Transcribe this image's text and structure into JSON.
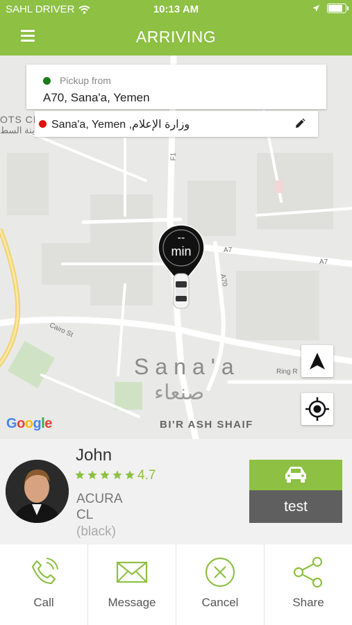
{
  "status_bar": {
    "carrier": "SAHL DRIVER",
    "time": "10:13 AM",
    "battery_level": 0.9
  },
  "header": {
    "title": "ARRIVING",
    "menu_icon": "hamburger-menu-icon"
  },
  "pickup": {
    "label": "Pickup from",
    "address": "A70,  Sana'a,  Yemen",
    "dot_color": "#1a7a1a"
  },
  "dropoff": {
    "address": "Sana'a,  Yemen ,وزارة الإعلام",
    "dot_color": "#e01010",
    "edit_icon": "pencil-icon"
  },
  "map": {
    "eta_value": "--",
    "eta_unit": "min",
    "city_name_en": "Sana'a",
    "city_name_ar": "صنعاء",
    "district": "BI'R ASH SHAIF",
    "labels": {
      "f1": "F1",
      "a7_1": "A7",
      "a7_2": "A7",
      "a70": "A70",
      "cairo_st": "Cairo St",
      "ring_rd": "Ring R",
      "top_left_1": "OTS CI",
      "top_left_2": "ينة السط"
    },
    "attribution": "Google",
    "nav_button_icon": "navigation-arrow-icon",
    "locate_button_icon": "my-location-icon"
  },
  "driver": {
    "name": "John",
    "stars": 5,
    "rating": "4.7",
    "car_make": "ACURA",
    "car_model": "CL",
    "car_color": "(black)",
    "plate": "test",
    "car_button_icon": "car-icon"
  },
  "actions": [
    {
      "label": "Call",
      "icon": "phone-icon"
    },
    {
      "label": "Message",
      "icon": "envelope-icon"
    },
    {
      "label": "Cancel",
      "icon": "close-circle-icon"
    },
    {
      "label": "Share",
      "icon": "share-icon"
    }
  ],
  "colors": {
    "brand": "#8dc043",
    "plate_bg": "#5f5f5f",
    "map_bg": "#e9e9e7"
  }
}
